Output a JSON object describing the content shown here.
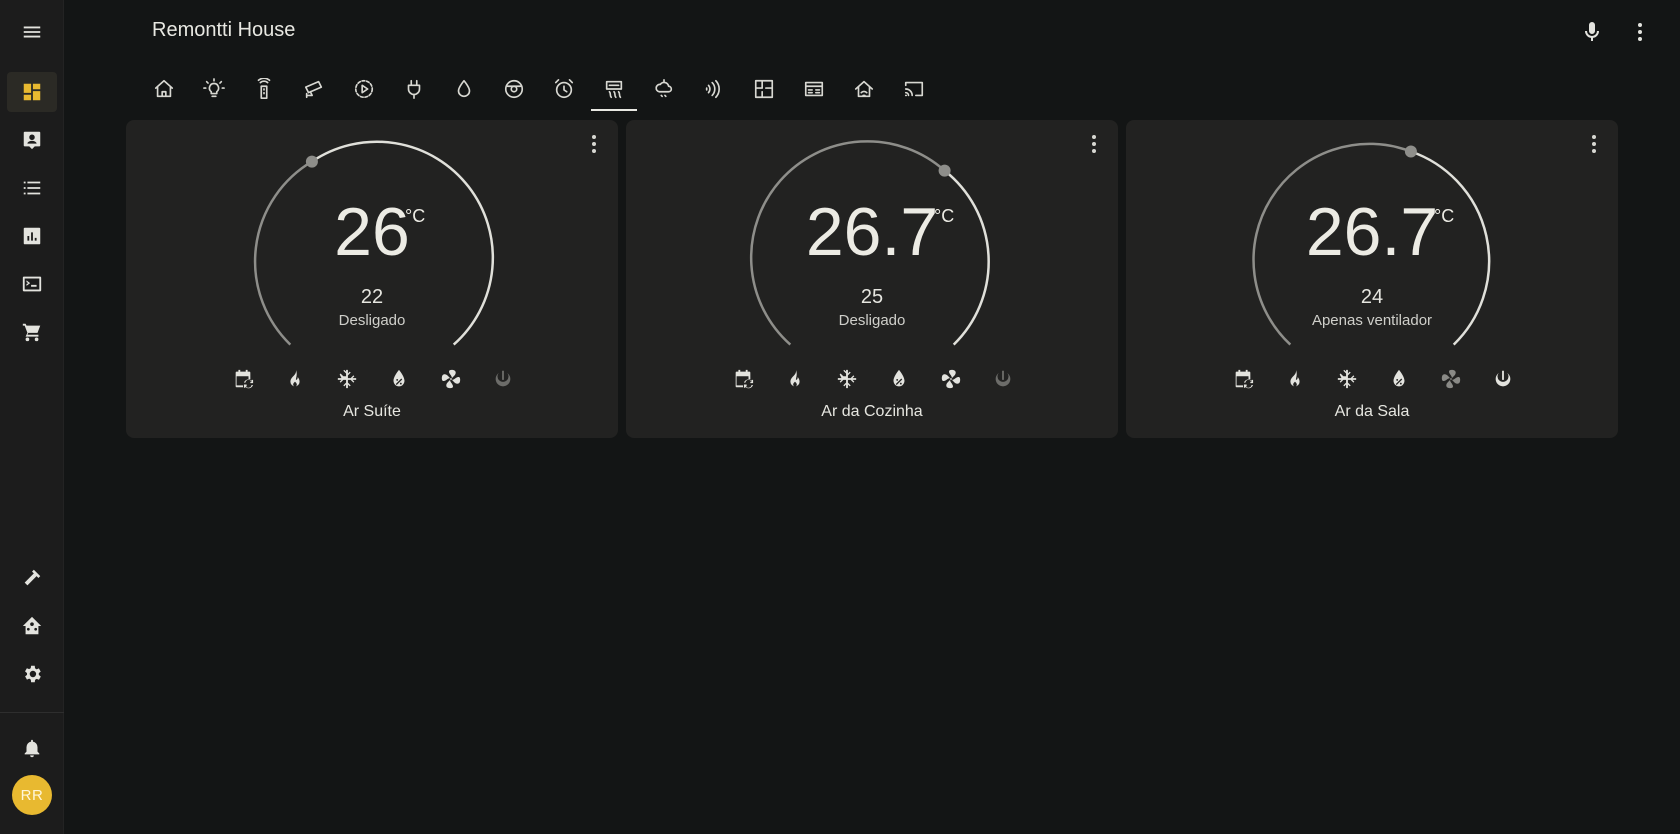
{
  "app": {
    "title": "Remontti House"
  },
  "sidebar": {
    "items": [
      {
        "name": "overview",
        "icon": "dashboard-icon"
      },
      {
        "name": "map",
        "icon": "account-box-icon"
      },
      {
        "name": "logbook",
        "icon": "format-list-icon"
      },
      {
        "name": "history",
        "icon": "chart-box-icon"
      },
      {
        "name": "terminal",
        "icon": "console-icon"
      },
      {
        "name": "shopping-list",
        "icon": "cart-icon"
      }
    ],
    "bottom_items": [
      {
        "name": "developer-tools",
        "icon": "hammer-icon"
      },
      {
        "name": "home-assistant",
        "icon": "home-assistant-icon"
      },
      {
        "name": "settings",
        "icon": "gear-icon"
      },
      {
        "name": "notifications",
        "icon": "bell-icon"
      }
    ],
    "user_initials": "RR"
  },
  "toolbar": {
    "voice_icon": "microphone-icon",
    "menu_icon": "dots-vertical-icon"
  },
  "tabs": [
    {
      "icon": "home-icon"
    },
    {
      "icon": "lightbulb-icon"
    },
    {
      "icon": "remote-icon"
    },
    {
      "icon": "cctv-icon"
    },
    {
      "icon": "play-circle-icon"
    },
    {
      "icon": "power-plug-icon"
    },
    {
      "icon": "water-icon"
    },
    {
      "icon": "robot-vacuum-icon"
    },
    {
      "icon": "alarm-icon"
    },
    {
      "icon": "air-conditioner-icon",
      "active": true
    },
    {
      "icon": "weather-icon"
    },
    {
      "icon": "nfc-icon"
    },
    {
      "icon": "floor-plan-icon"
    },
    {
      "icon": "server-icon"
    },
    {
      "icon": "wifi-home-icon"
    },
    {
      "icon": "cast-icon"
    }
  ],
  "cards": [
    {
      "name": "Ar Suíte",
      "current_temp": "26",
      "unit": "°C",
      "target": "22",
      "state": "Desligado",
      "active_mode": "off"
    },
    {
      "name": "Ar da Cozinha",
      "current_temp": "26.7",
      "unit": "°C",
      "target": "25",
      "state": "Desligado",
      "active_mode": "off"
    },
    {
      "name": "Ar da Sala",
      "current_temp": "26.7",
      "unit": "°C",
      "target": "24",
      "state": "Apenas ventilador",
      "active_mode": "fan_only"
    }
  ],
  "colors": {
    "accent": "#e8b930",
    "background": "#131515",
    "card": "#222221"
  }
}
